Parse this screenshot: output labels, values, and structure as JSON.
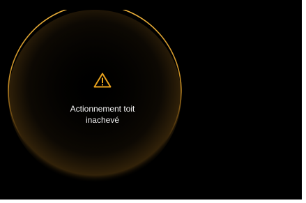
{
  "alert": {
    "icon": "warning-triangle-icon",
    "accent_color": "#e8a21e",
    "message_line1": "Actionnement toit",
    "message_line2": "inachevé"
  },
  "colors": {
    "background": "#000000",
    "ring": "#e2a12a",
    "text": "#f2f2f2"
  }
}
